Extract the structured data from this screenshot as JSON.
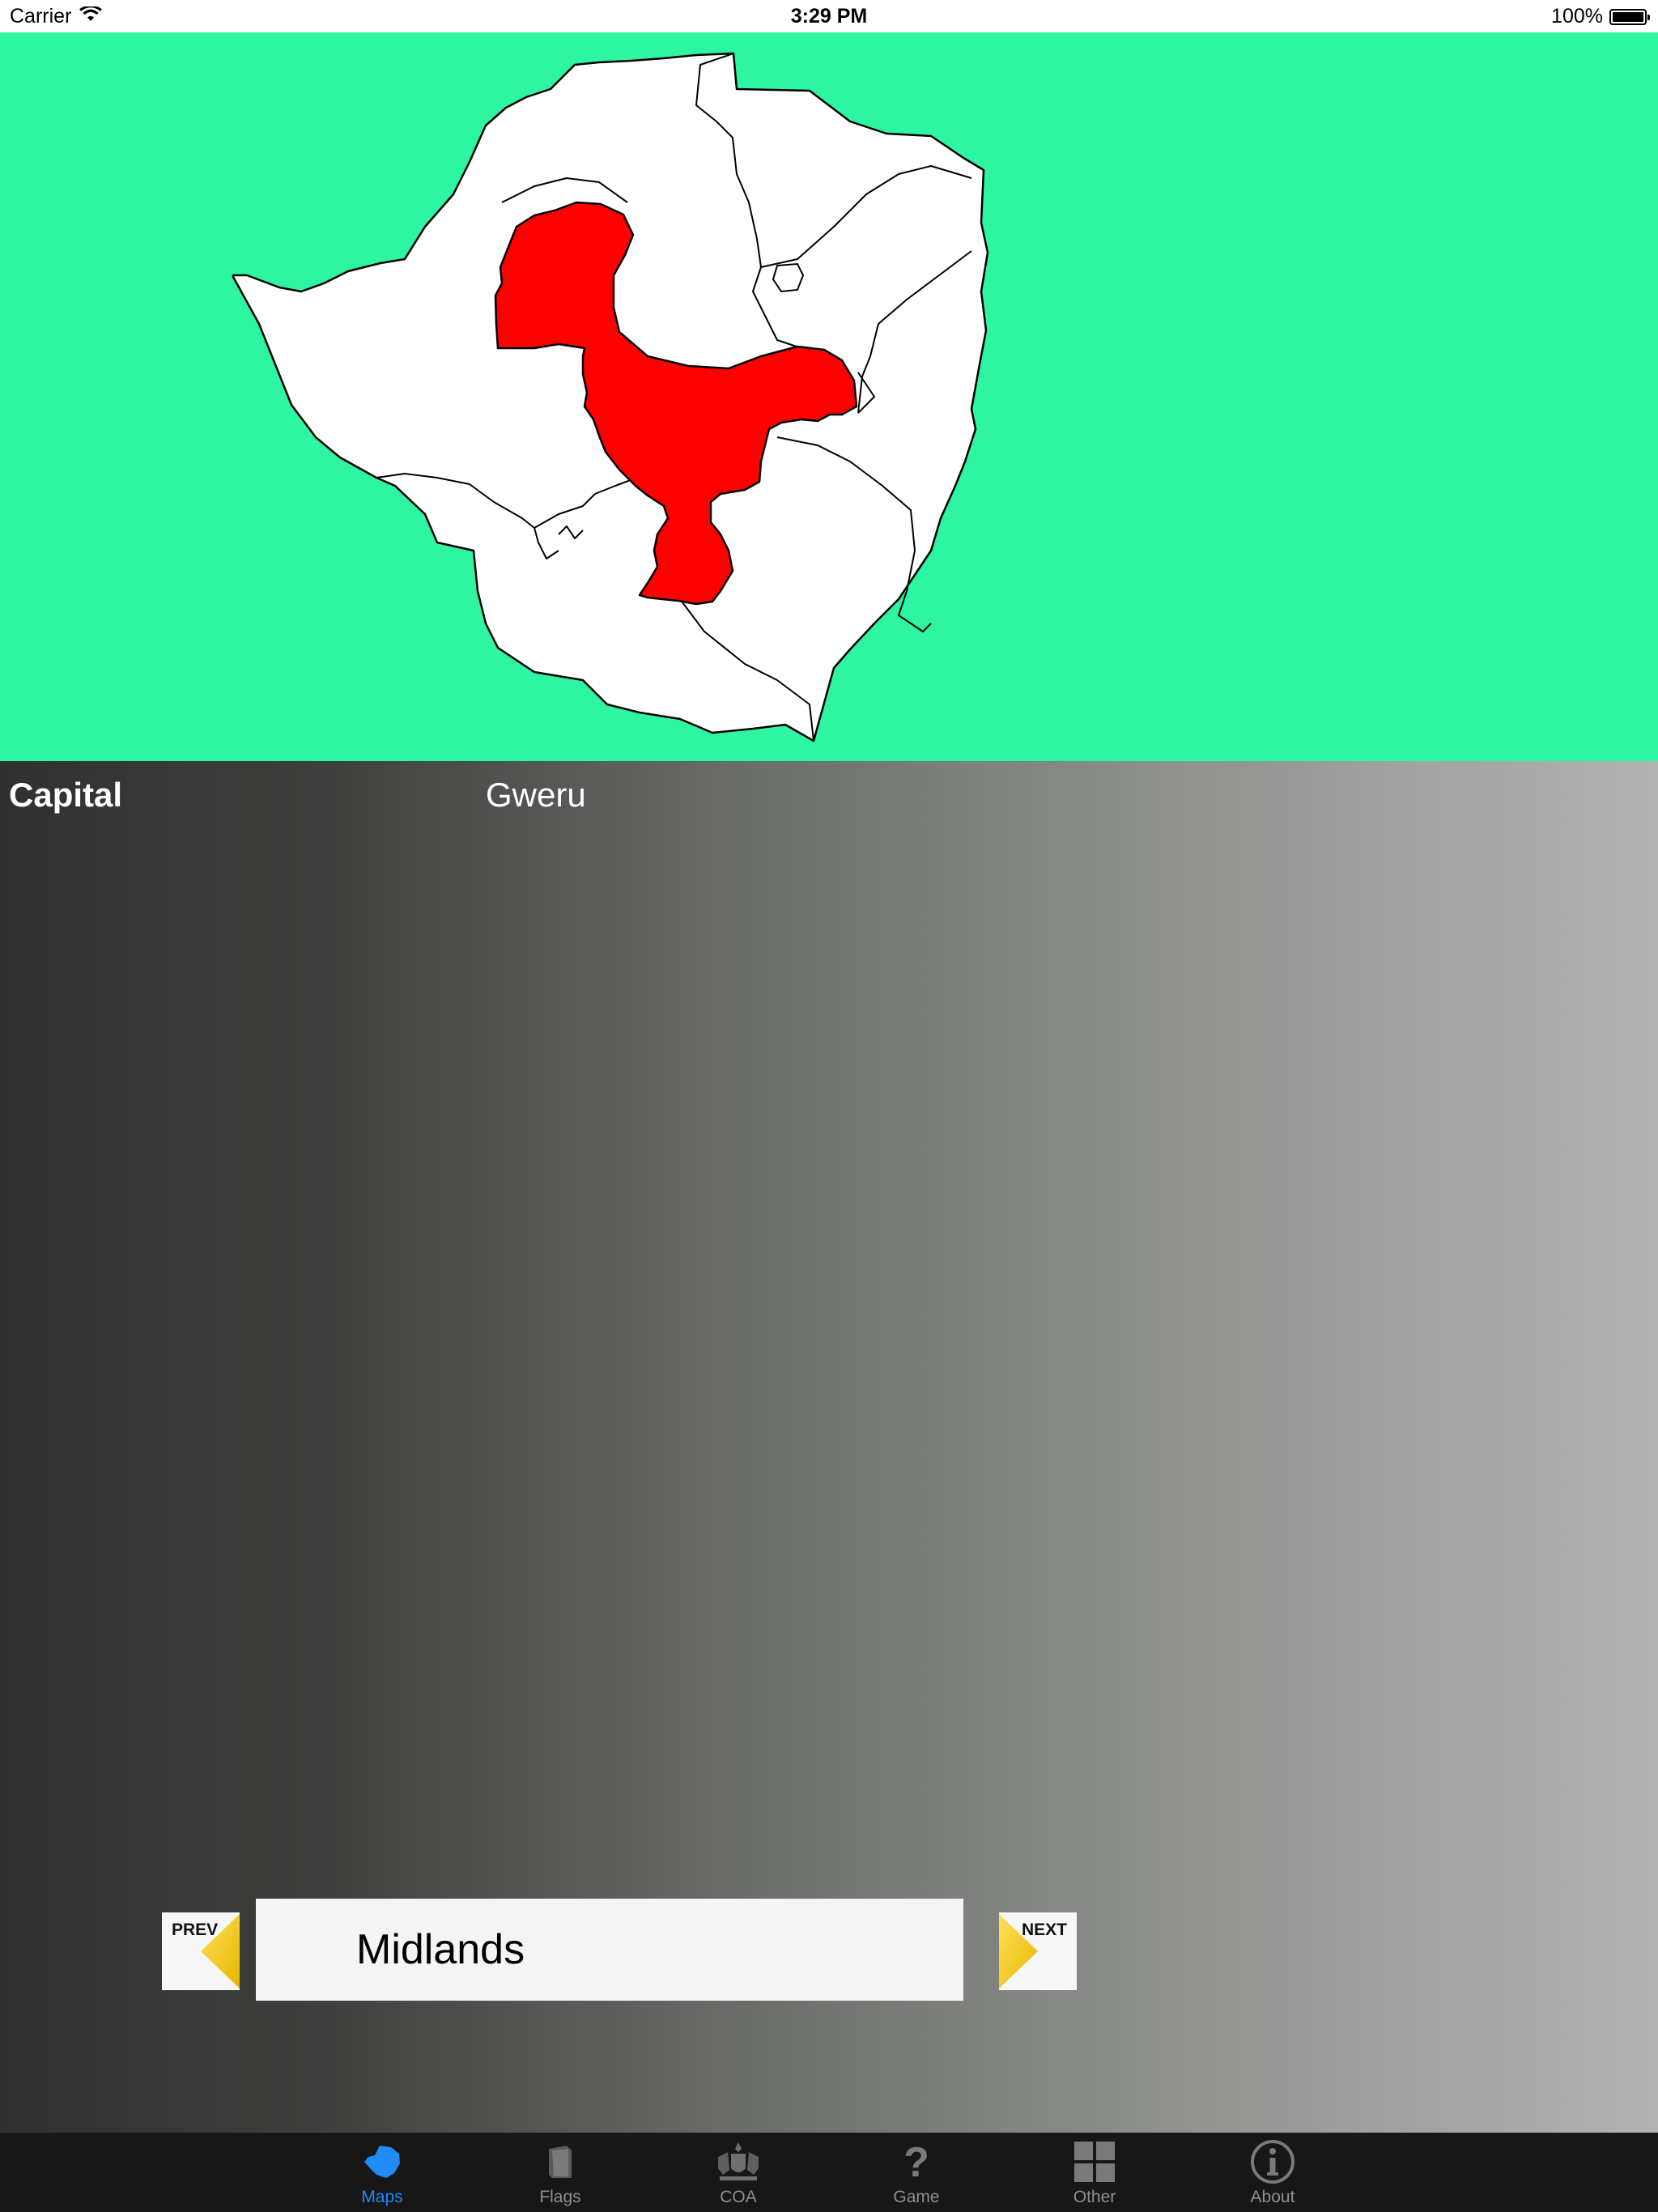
{
  "status_bar": {
    "carrier": "Carrier",
    "time": "3:29 PM",
    "battery": "100%"
  },
  "map": {
    "background_color": "#2df5a2",
    "country_fill": "#ffffff",
    "highlight_fill": "#ff0000",
    "highlighted_region": "Midlands"
  },
  "capital": {
    "label": "Capital",
    "value": "Gweru"
  },
  "navigation": {
    "prev_label": "PREV",
    "next_label": "NEXT",
    "current_region": "Midlands",
    "arrow_color": "#f3c81e"
  },
  "tab_bar": {
    "active_color": "#1f8bf5",
    "inactive_color": "#8f8f8f",
    "tabs": [
      {
        "label": "Maps",
        "icon": "map-icon",
        "active": true
      },
      {
        "label": "Flags",
        "icon": "flag-icon",
        "active": false
      },
      {
        "label": "COA",
        "icon": "coat-of-arms-icon",
        "active": false
      },
      {
        "label": "Game",
        "icon": "question-icon",
        "active": false
      },
      {
        "label": "Other",
        "icon": "grid-icon",
        "active": false
      },
      {
        "label": "About",
        "icon": "info-icon",
        "active": false
      }
    ]
  }
}
